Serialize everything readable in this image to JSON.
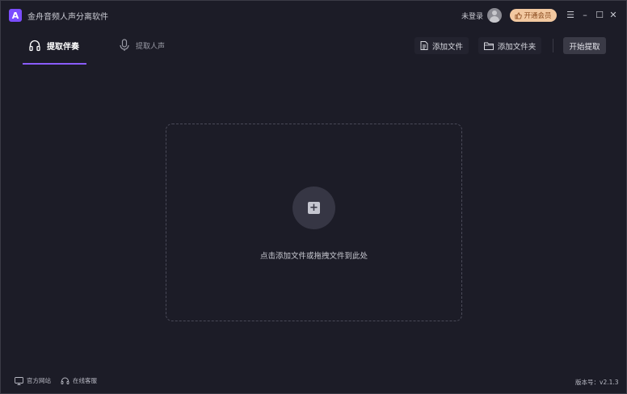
{
  "app": {
    "logo_letter": "A",
    "title": "金舟音频人声分离软件"
  },
  "header": {
    "login_text": "未登录",
    "vip_label": "开通会员",
    "window_controls": {
      "menu": "☰",
      "minimize": "–",
      "maximize": "☐",
      "close": "✕"
    }
  },
  "tabs": [
    {
      "label": "提取伴奏",
      "active": true,
      "icon": "headphones-icon"
    },
    {
      "label": "提取人声",
      "active": false,
      "icon": "microphone-icon"
    }
  ],
  "toolbar": {
    "add_file": "添加文件",
    "add_folder": "添加文件夹",
    "start": "开始提取"
  },
  "dropzone": {
    "plus": "+",
    "hint": "点击添加文件或拖拽文件到此处"
  },
  "footer": {
    "website": "官方网站",
    "service": "在线客服",
    "version": "版本号：v2.1.3"
  },
  "colors": {
    "background": "#1c1c27",
    "accent": "#8a5cff",
    "vip": "#f2c8a0",
    "button": "#23232f"
  }
}
